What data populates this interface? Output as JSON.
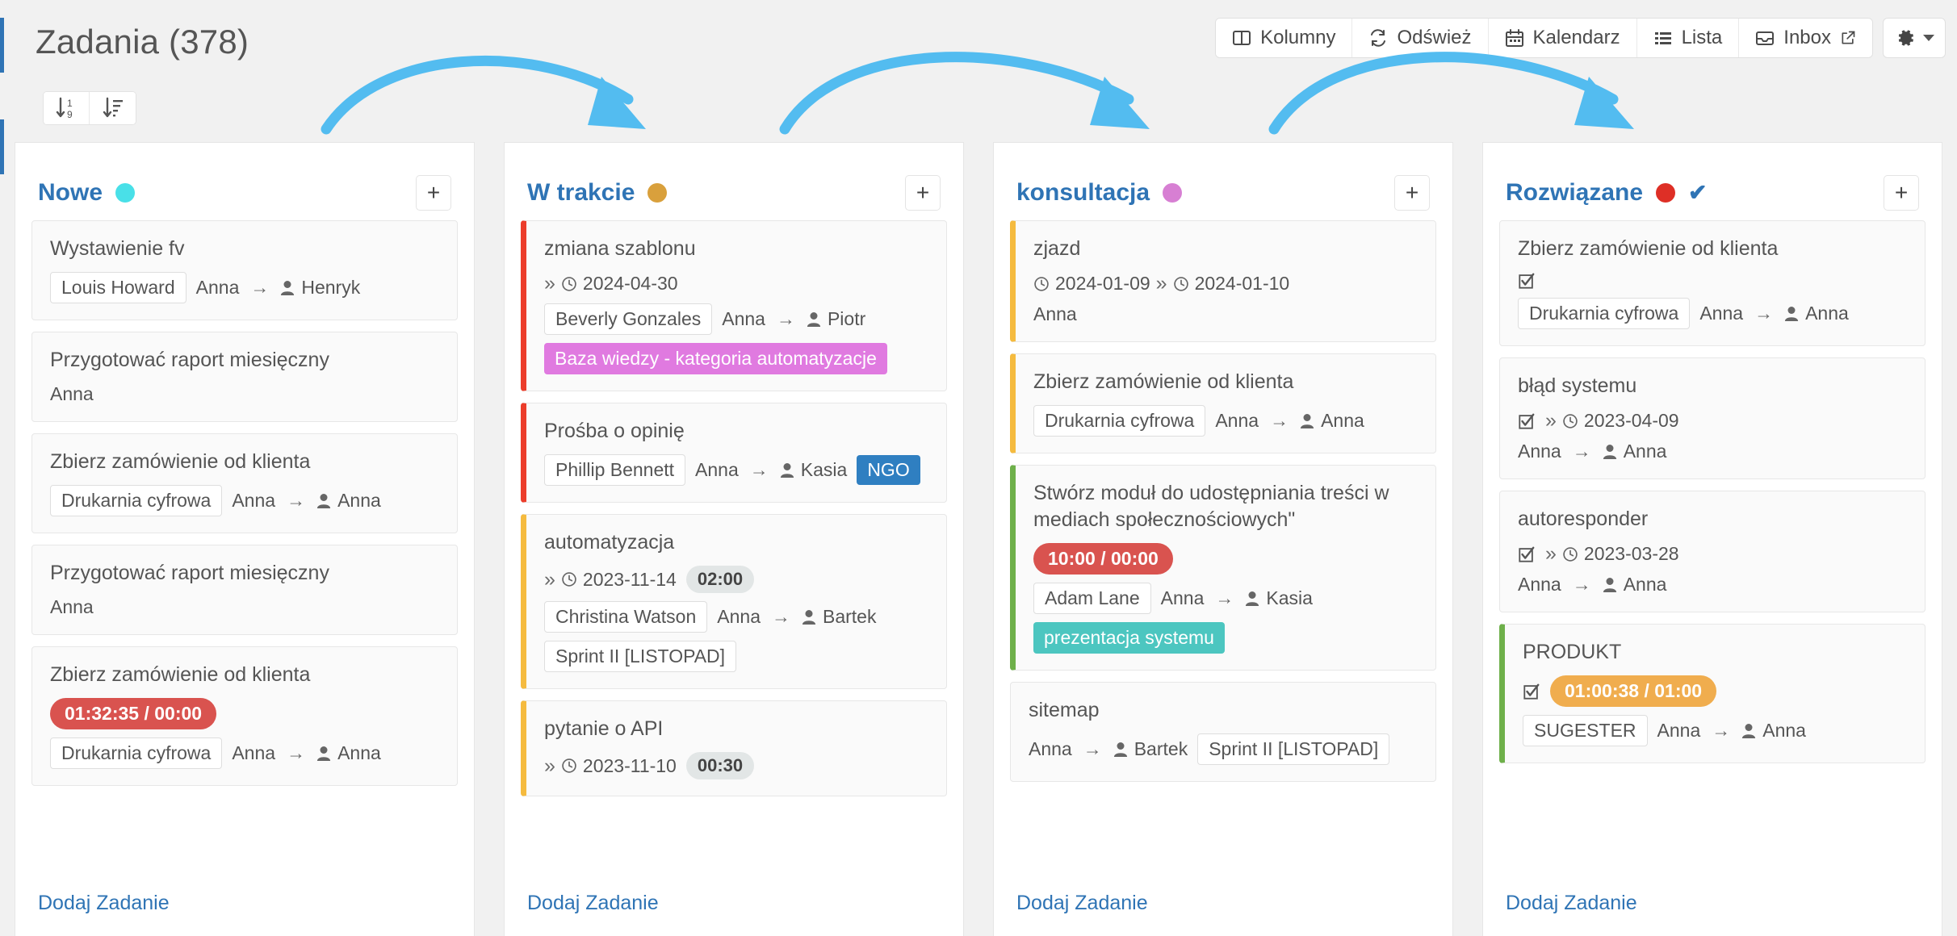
{
  "header": {
    "title": "Zadania (378)",
    "sort_buttons": [
      {
        "name": "sort-numeric-button",
        "glyph": "↓1₉"
      },
      {
        "name": "sort-amount-button",
        "glyph": "↓≡"
      }
    ],
    "toolbar": [
      {
        "label": "Kolumny",
        "icon": "columns-icon"
      },
      {
        "label": "Odśwież",
        "icon": "refresh-icon"
      },
      {
        "label": "Kalendarz",
        "icon": "calendar-icon"
      },
      {
        "label": "Lista",
        "icon": "list-icon"
      },
      {
        "label": "Inbox",
        "icon": "inbox-icon",
        "external": true
      }
    ],
    "settings_label": "⚙"
  },
  "colors": {
    "accent_blue": "#2f74b5",
    "arrow_blue": "#53bcf0",
    "dot_nowe": "#49e0e8",
    "dot_wtrakcie": "#d9a03c",
    "dot_konsultacja": "#d77fd3",
    "dot_rozwiazane": "#de2f26",
    "border_red": "#ec3d2b",
    "border_yellow": "#f5bb3f",
    "border_green": "#6eb04a",
    "tag_pink": "#e07ae0",
    "tag_teal": "#4cc6c0",
    "badge_red": "#d9534f",
    "badge_orange": "#f0ad4e",
    "badge_blue": "#2f7fc1"
  },
  "add_task_label": "Dodaj Zadanie",
  "columns": [
    {
      "name": "Nowe",
      "dot": "#49e0e8",
      "has_check": false,
      "add_label": "+",
      "cards": [
        {
          "title": "Wystawienie fv",
          "left_border": null,
          "checkbox": false,
          "dates": [],
          "duration": null,
          "timer": null,
          "project": "Louis Howard",
          "author": "Anna",
          "assignee": "Henryk",
          "tags": [],
          "badge": null,
          "sprint": null
        },
        {
          "title": "Przygotować raport miesięczny",
          "left_border": null,
          "checkbox": false,
          "dates": [],
          "duration": null,
          "timer": null,
          "project": null,
          "author": "Anna",
          "assignee": null,
          "tags": [],
          "badge": null,
          "sprint": null
        },
        {
          "title": "Zbierz zamówienie od klienta",
          "left_border": null,
          "checkbox": false,
          "dates": [],
          "duration": null,
          "timer": null,
          "project": "Drukarnia cyfrowa",
          "author": "Anna",
          "assignee": "Anna",
          "tags": [],
          "badge": null,
          "sprint": null
        },
        {
          "title": "Przygotować raport miesięczny",
          "left_border": null,
          "checkbox": false,
          "dates": [],
          "duration": null,
          "timer": null,
          "project": null,
          "author": "Anna",
          "assignee": null,
          "tags": [],
          "badge": null,
          "sprint": null
        },
        {
          "title": "Zbierz zamówienie od klienta",
          "left_border": null,
          "checkbox": false,
          "dates": [],
          "duration": null,
          "timer": {
            "text": "01:32:35 / 00:00",
            "color": "#d9534f"
          },
          "project": "Drukarnia cyfrowa",
          "author": "Anna",
          "assignee": "Anna",
          "tags": [],
          "badge": null,
          "sprint": null
        }
      ]
    },
    {
      "name": "W trakcie",
      "dot": "#d9a03c",
      "has_check": false,
      "add_label": "+",
      "cards": [
        {
          "title": "zmiana szablonu",
          "left_border": "#ec3d2b",
          "checkbox": false,
          "dates": [
            "2024-04-30"
          ],
          "date_prefix": "»",
          "duration": null,
          "timer": null,
          "project": "Beverly Gonzales",
          "author": "Anna",
          "assignee": "Piotr",
          "tags": [
            {
              "label": "Baza wiedzy - kategoria automatyzacje",
              "color": "#e07ae0"
            }
          ],
          "badge": null,
          "sprint": null
        },
        {
          "title": "Prośba o opinię",
          "left_border": "#ec3d2b",
          "checkbox": false,
          "dates": [],
          "duration": null,
          "timer": null,
          "project": "Phillip Bennett",
          "author": "Anna",
          "assignee": "Kasia",
          "tags": [],
          "badge": {
            "label": "NGO",
            "color": "#2f7fc1"
          },
          "sprint": null
        },
        {
          "title": "automatyzacja",
          "left_border": "#f5bb3f",
          "checkbox": false,
          "dates": [
            "2023-11-14"
          ],
          "date_prefix": "»",
          "duration": "02:00",
          "timer": null,
          "project": "Christina Watson",
          "author": "Anna",
          "assignee": "Bartek",
          "tags": [],
          "badge": null,
          "sprint": "Sprint II [LISTOPAD]"
        },
        {
          "title": "pytanie o API",
          "left_border": "#f5bb3f",
          "checkbox": false,
          "dates": [
            "2023-11-10"
          ],
          "date_prefix": "»",
          "duration": "00:30",
          "timer": null,
          "project": null,
          "author": null,
          "assignee": null,
          "tags": [],
          "badge": null,
          "sprint": null
        }
      ]
    },
    {
      "name": "konsultacja",
      "dot": "#d77fd3",
      "has_check": false,
      "add_label": "+",
      "cards": [
        {
          "title": "zjazd",
          "left_border": "#f5bb3f",
          "checkbox": false,
          "dates": [
            "2024-01-09",
            "2024-01-10"
          ],
          "date_prefix": "",
          "duration": null,
          "timer": null,
          "project": null,
          "author": "Anna",
          "assignee": null,
          "tags": [],
          "badge": null,
          "sprint": null
        },
        {
          "title": "Zbierz zamówienie od klienta",
          "left_border": "#f5bb3f",
          "checkbox": false,
          "dates": [],
          "duration": null,
          "timer": null,
          "project": "Drukarnia cyfrowa",
          "author": "Anna",
          "assignee": "Anna",
          "tags": [],
          "badge": null,
          "sprint": null
        },
        {
          "title": "Stwórz moduł do udostępniania treści w mediach społecznościowych\"",
          "left_border": "#6eb04a",
          "checkbox": false,
          "dates": [],
          "duration": null,
          "timer": {
            "text": "10:00 / 00:00",
            "color": "#d9534f"
          },
          "project": "Adam Lane",
          "author": "Anna",
          "assignee": "Kasia",
          "tags": [
            {
              "label": "prezentacja systemu",
              "color": "#4cc6c0"
            }
          ],
          "badge": null,
          "sprint": null
        },
        {
          "title": "sitemap",
          "left_border": null,
          "checkbox": false,
          "dates": [],
          "duration": null,
          "timer": null,
          "project": null,
          "author": "Anna",
          "assignee": "Bartek",
          "tags": [],
          "badge": null,
          "sprint": "Sprint II [LISTOPAD]"
        }
      ]
    },
    {
      "name": "Rozwiązane",
      "dot": "#de2f26",
      "has_check": true,
      "add_label": "+",
      "cards": [
        {
          "title": "Zbierz zamówienie od klienta",
          "left_border": null,
          "checkbox": true,
          "dates": [],
          "duration": null,
          "timer": null,
          "project": "Drukarnia cyfrowa",
          "author": "Anna",
          "assignee": "Anna",
          "tags": [],
          "badge": null,
          "sprint": null
        },
        {
          "title": "błąd systemu",
          "left_border": null,
          "checkbox": true,
          "dates": [
            "2023-04-09"
          ],
          "date_prefix": "»",
          "duration": null,
          "timer": null,
          "project": null,
          "author": "Anna",
          "assignee": "Anna",
          "tags": [],
          "badge": null,
          "sprint": null
        },
        {
          "title": "autoresponder",
          "left_border": null,
          "checkbox": true,
          "dates": [
            "2023-03-28"
          ],
          "date_prefix": "»",
          "duration": null,
          "timer": null,
          "project": null,
          "author": "Anna",
          "assignee": "Anna",
          "tags": [],
          "badge": null,
          "sprint": null
        },
        {
          "title": "PRODUKT",
          "left_border": "#6eb04a",
          "checkbox": true,
          "dates": [],
          "duration": null,
          "timer": {
            "text": "01:00:38 / 01:00",
            "color": "#f0ad4e"
          },
          "project": "SUGESTER",
          "author": "Anna",
          "assignee": "Anna",
          "tags": [],
          "badge": null,
          "sprint": null
        }
      ]
    }
  ],
  "annotations": {
    "arrows": [
      {
        "name": "arrow-nowe-to-wtrakcie"
      },
      {
        "name": "arrow-wtrakcie-to-konsultacja"
      },
      {
        "name": "arrow-konsultacja-to-rozwiazane"
      }
    ]
  }
}
